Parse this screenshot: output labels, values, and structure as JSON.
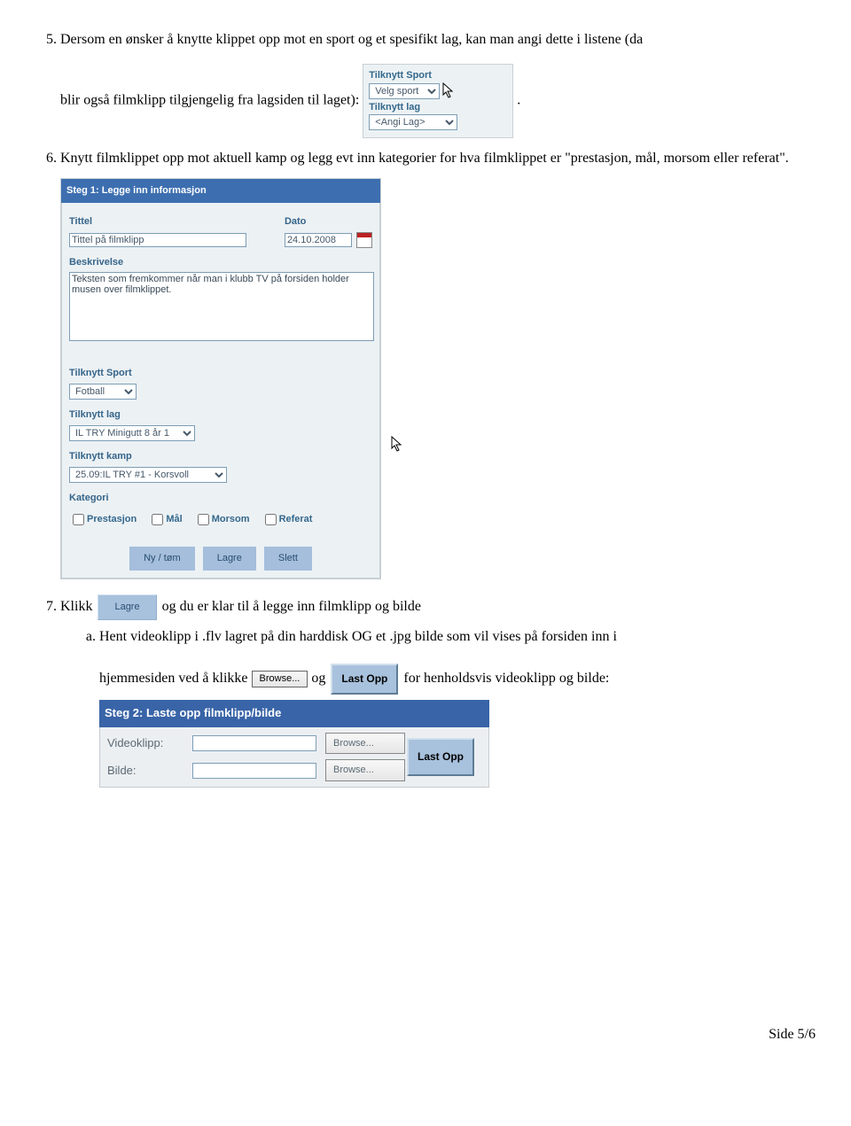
{
  "list": {
    "item5_a": "Dersom en ønsker å knytte klippet opp mot en sport og et spesifikt lag, kan man angi dette i listene (da",
    "item5_b": "blir også filmklipp tilgjengelig fra lagsiden til laget):  ",
    "item5_c": ".",
    "item6": "Knytt filmklippet opp mot aktuell kamp og legg evt inn kategorier for hva filmklippet er \"prestasjon, mål, morsom eller referat\".",
    "item7_a": "Klikk ",
    "item7_b": " og du er klar til å legge inn filmklipp og bilde",
    "item7a_a": "Hent videoklipp i .flv lagret på din harddisk  OG et .jpg bilde som vil vises på forsiden inn i",
    "item7a_b": "hjemmesiden ved å klikke ",
    "item7a_c": " og ",
    "item7a_d": " for henholdsvis videoklipp og bilde:"
  },
  "panel_small": {
    "tilknytt_sport": "Tilknytt Sport",
    "velg_sport": "Velg sport",
    "tilknytt_lag": "Tilknytt lag",
    "angi_lag": "<Angi Lag>"
  },
  "form1": {
    "titlebar": "Steg 1: Legge inn informasjon",
    "l_tittel": "Tittel",
    "l_dato": "Dato",
    "ph_tittel": "Tittel på filmklipp",
    "v_dato": "24.10.2008",
    "l_beskrivelse": "Beskrivelse",
    "v_beskrivelse": "Teksten som fremkommer når man i klubb TV på forsiden holder musen over filmklippet.",
    "l_sport": "Tilknytt Sport",
    "v_sport": "Fotball",
    "l_lag": "Tilknytt lag",
    "v_lag": "IL TRY Minigutt 8 år 1",
    "l_kamp": "Tilknytt kamp",
    "v_kamp": "25.09:IL TRY #1 - Korsvoll",
    "l_kategori": "Kategori",
    "k_prestasjon": "Prestasjon",
    "k_maal": "Mål",
    "k_morsom": "Morsom",
    "k_referat": "Referat",
    "btn_ny": "Ny / tøm",
    "btn_lagre": "Lagre",
    "btn_slett": "Slett"
  },
  "inline": {
    "lagre": "Lagre",
    "browse": "Browse...",
    "lastopp": "Last Opp"
  },
  "step2": {
    "titlebar": "Steg 2: Laste opp filmklipp/bilde",
    "l_video": "Videoklipp:",
    "l_bilde": "Bilde:",
    "browse": "Browse...",
    "lastopp": "Last Opp"
  },
  "footer": "Side 5/6"
}
